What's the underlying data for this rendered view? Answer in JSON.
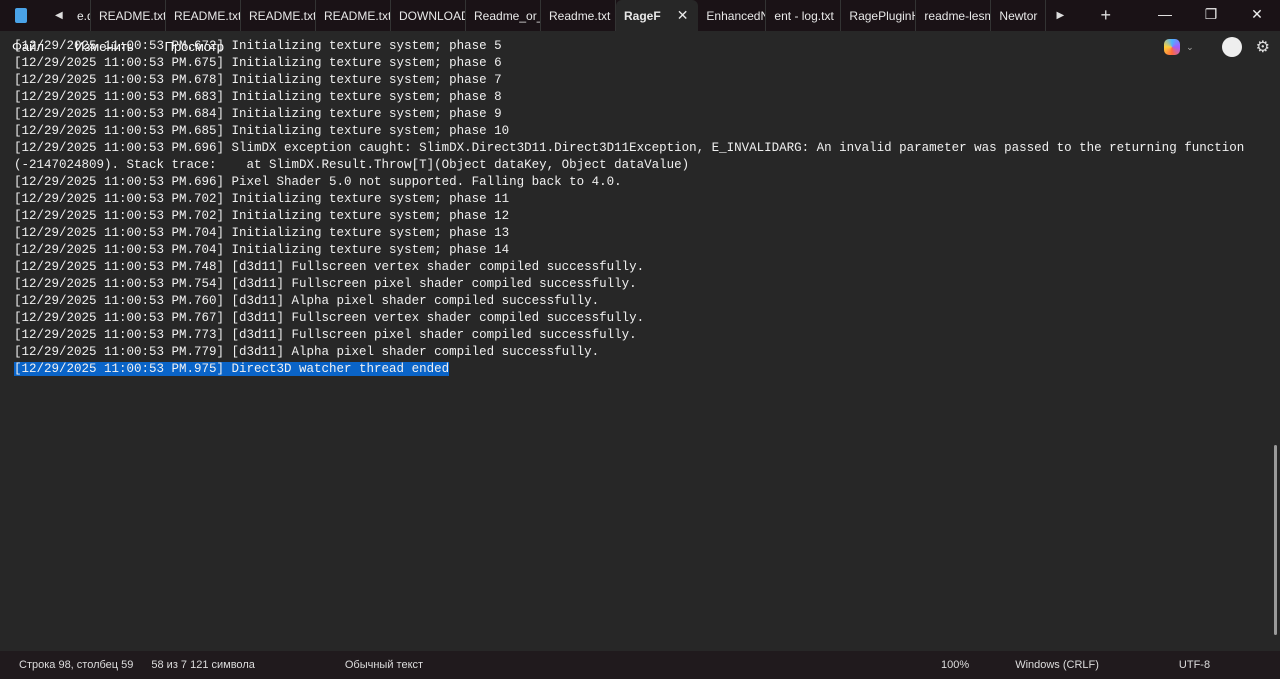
{
  "tabs": [
    "e.d",
    "README.txt",
    "README.txt",
    "README.txt",
    "README.txt",
    "DOWNLOAD",
    "Readme_or_r",
    "Readme.txt",
    "RageF",
    "EnhancedNa",
    "ent - log.txt",
    "RagePluginH",
    "readme-lesm",
    "Newtor"
  ],
  "active_tab_index": 8,
  "menu": [
    "Файл",
    "Изменить",
    "Просмотр"
  ],
  "lines": [
    "[12/29/2025 11:00:53 PM.672] Initializing texture system; phase 5",
    "[12/29/2025 11:00:53 PM.675] Initializing texture system; phase 6",
    "[12/29/2025 11:00:53 PM.678] Initializing texture system; phase 7",
    "[12/29/2025 11:00:53 PM.683] Initializing texture system; phase 8",
    "[12/29/2025 11:00:53 PM.684] Initializing texture system; phase 9",
    "[12/29/2025 11:00:53 PM.685] Initializing texture system; phase 10",
    "[12/29/2025 11:00:53 PM.696] SlimDX exception caught: SlimDX.Direct3D11.Direct3D11Exception, E_INVALIDARG: An invalid parameter was passed to the returning function",
    "(-2147024809). Stack trace:    at SlimDX.Result.Throw[T](Object dataKey, Object dataValue)",
    "[12/29/2025 11:00:53 PM.696] Pixel Shader 5.0 not supported. Falling back to 4.0.",
    "[12/29/2025 11:00:53 PM.702] Initializing texture system; phase 11",
    "[12/29/2025 11:00:53 PM.702] Initializing texture system; phase 12",
    "[12/29/2025 11:00:53 PM.704] Initializing texture system; phase 13",
    "[12/29/2025 11:00:53 PM.704] Initializing texture system; phase 14",
    "[12/29/2025 11:00:53 PM.748] [d3d11] Fullscreen vertex shader compiled successfully.",
    "[12/29/2025 11:00:53 PM.754] [d3d11] Fullscreen pixel shader compiled successfully.",
    "[12/29/2025 11:00:53 PM.760] [d3d11] Alpha pixel shader compiled successfully.",
    "[12/29/2025 11:00:53 PM.767] [d3d11] Fullscreen vertex shader compiled successfully.",
    "[12/29/2025 11:00:53 PM.773] [d3d11] Fullscreen pixel shader compiled successfully.",
    "[12/29/2025 11:00:53 PM.779] [d3d11] Alpha pixel shader compiled successfully.",
    "[12/29/2025 11:00:53 PM.975] Direct3D watcher thread ended"
  ],
  "selected_line_index": 19,
  "status": {
    "position": "Строка 98, столбец 59",
    "selection": "58 из 7 121 символа",
    "format": "Обычный текст",
    "zoom": "100%",
    "line_ending": "Windows (CRLF)",
    "encoding": "UTF-8"
  }
}
